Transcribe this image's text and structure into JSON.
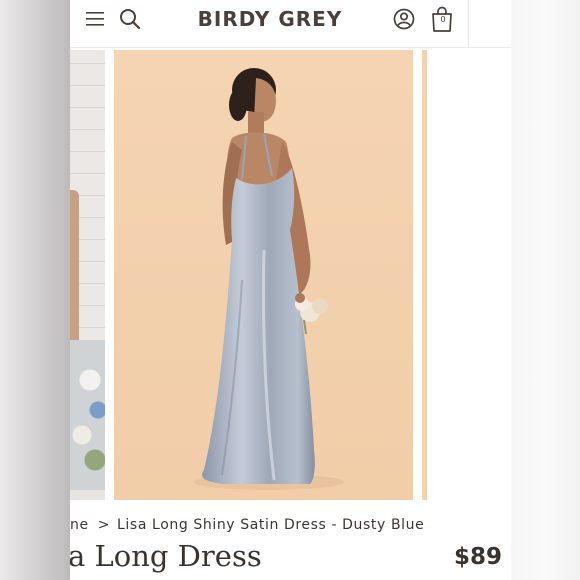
{
  "header": {
    "logo": "BIRDY GREY",
    "cart_count": "0",
    "icons": [
      "hamburger-menu-icon",
      "search-icon",
      "account-icon",
      "shopping-bag-icon"
    ]
  },
  "gallery": {
    "images": [
      "model in dusty blue satin dress with bouquet",
      "adjacent product photo",
      "next product photo"
    ]
  },
  "breadcrumb": {
    "home": "ne",
    "separator": ">",
    "current": "Lisa Long Shiny Satin Dress - Dusty Blue"
  },
  "product": {
    "title": "a Long Dress",
    "price": "$89"
  },
  "colors": {
    "brand_text": "#4a3f3a",
    "photo_background": "#f3d3b0",
    "dress": "#a9b3c2"
  }
}
